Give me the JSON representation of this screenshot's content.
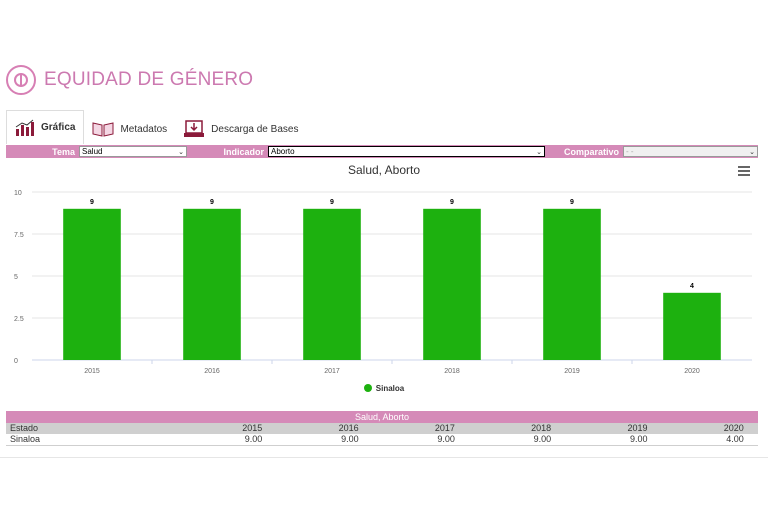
{
  "header": {
    "title": "EQUIDAD DE GÉNERO"
  },
  "tabs": [
    {
      "label": "Gráfica",
      "icon": "bar-chart-icon",
      "active": true
    },
    {
      "label": "Metadatos",
      "icon": "book-icon",
      "active": false
    },
    {
      "label": "Descarga de Bases",
      "icon": "download-icon",
      "active": false
    }
  ],
  "filters": {
    "tema_label": "Tema",
    "tema_value": "Salud",
    "indicador_label": "Indicador",
    "indicador_value": "Aborto",
    "comparativo_label": "Comparativo",
    "comparativo_value": "- -"
  },
  "chart_data": {
    "type": "bar",
    "title": "Salud, Aborto",
    "categories": [
      "2015",
      "2016",
      "2017",
      "2018",
      "2019",
      "2020"
    ],
    "series": [
      {
        "name": "Sinaloa",
        "values": [
          9,
          9,
          9,
          9,
          9,
          4
        ],
        "color": "#1db10f"
      }
    ],
    "ylim": [
      0,
      10
    ],
    "yticks": [
      "0",
      "2.5",
      "5",
      "7.5",
      "10"
    ],
    "grid": true,
    "legend_position": "bottom-center"
  },
  "table": {
    "caption": "Salud, Aborto",
    "header": [
      "Estado",
      "2015",
      "2016",
      "2017",
      "2018",
      "2019",
      "2020"
    ],
    "rows": [
      [
        "Sinaloa",
        "9.00",
        "9.00",
        "9.00",
        "9.00",
        "9.00",
        "4.00"
      ]
    ]
  },
  "colors": {
    "accent": "#d58ab8",
    "bar": "#1db10f",
    "title": "#cc79b0"
  }
}
